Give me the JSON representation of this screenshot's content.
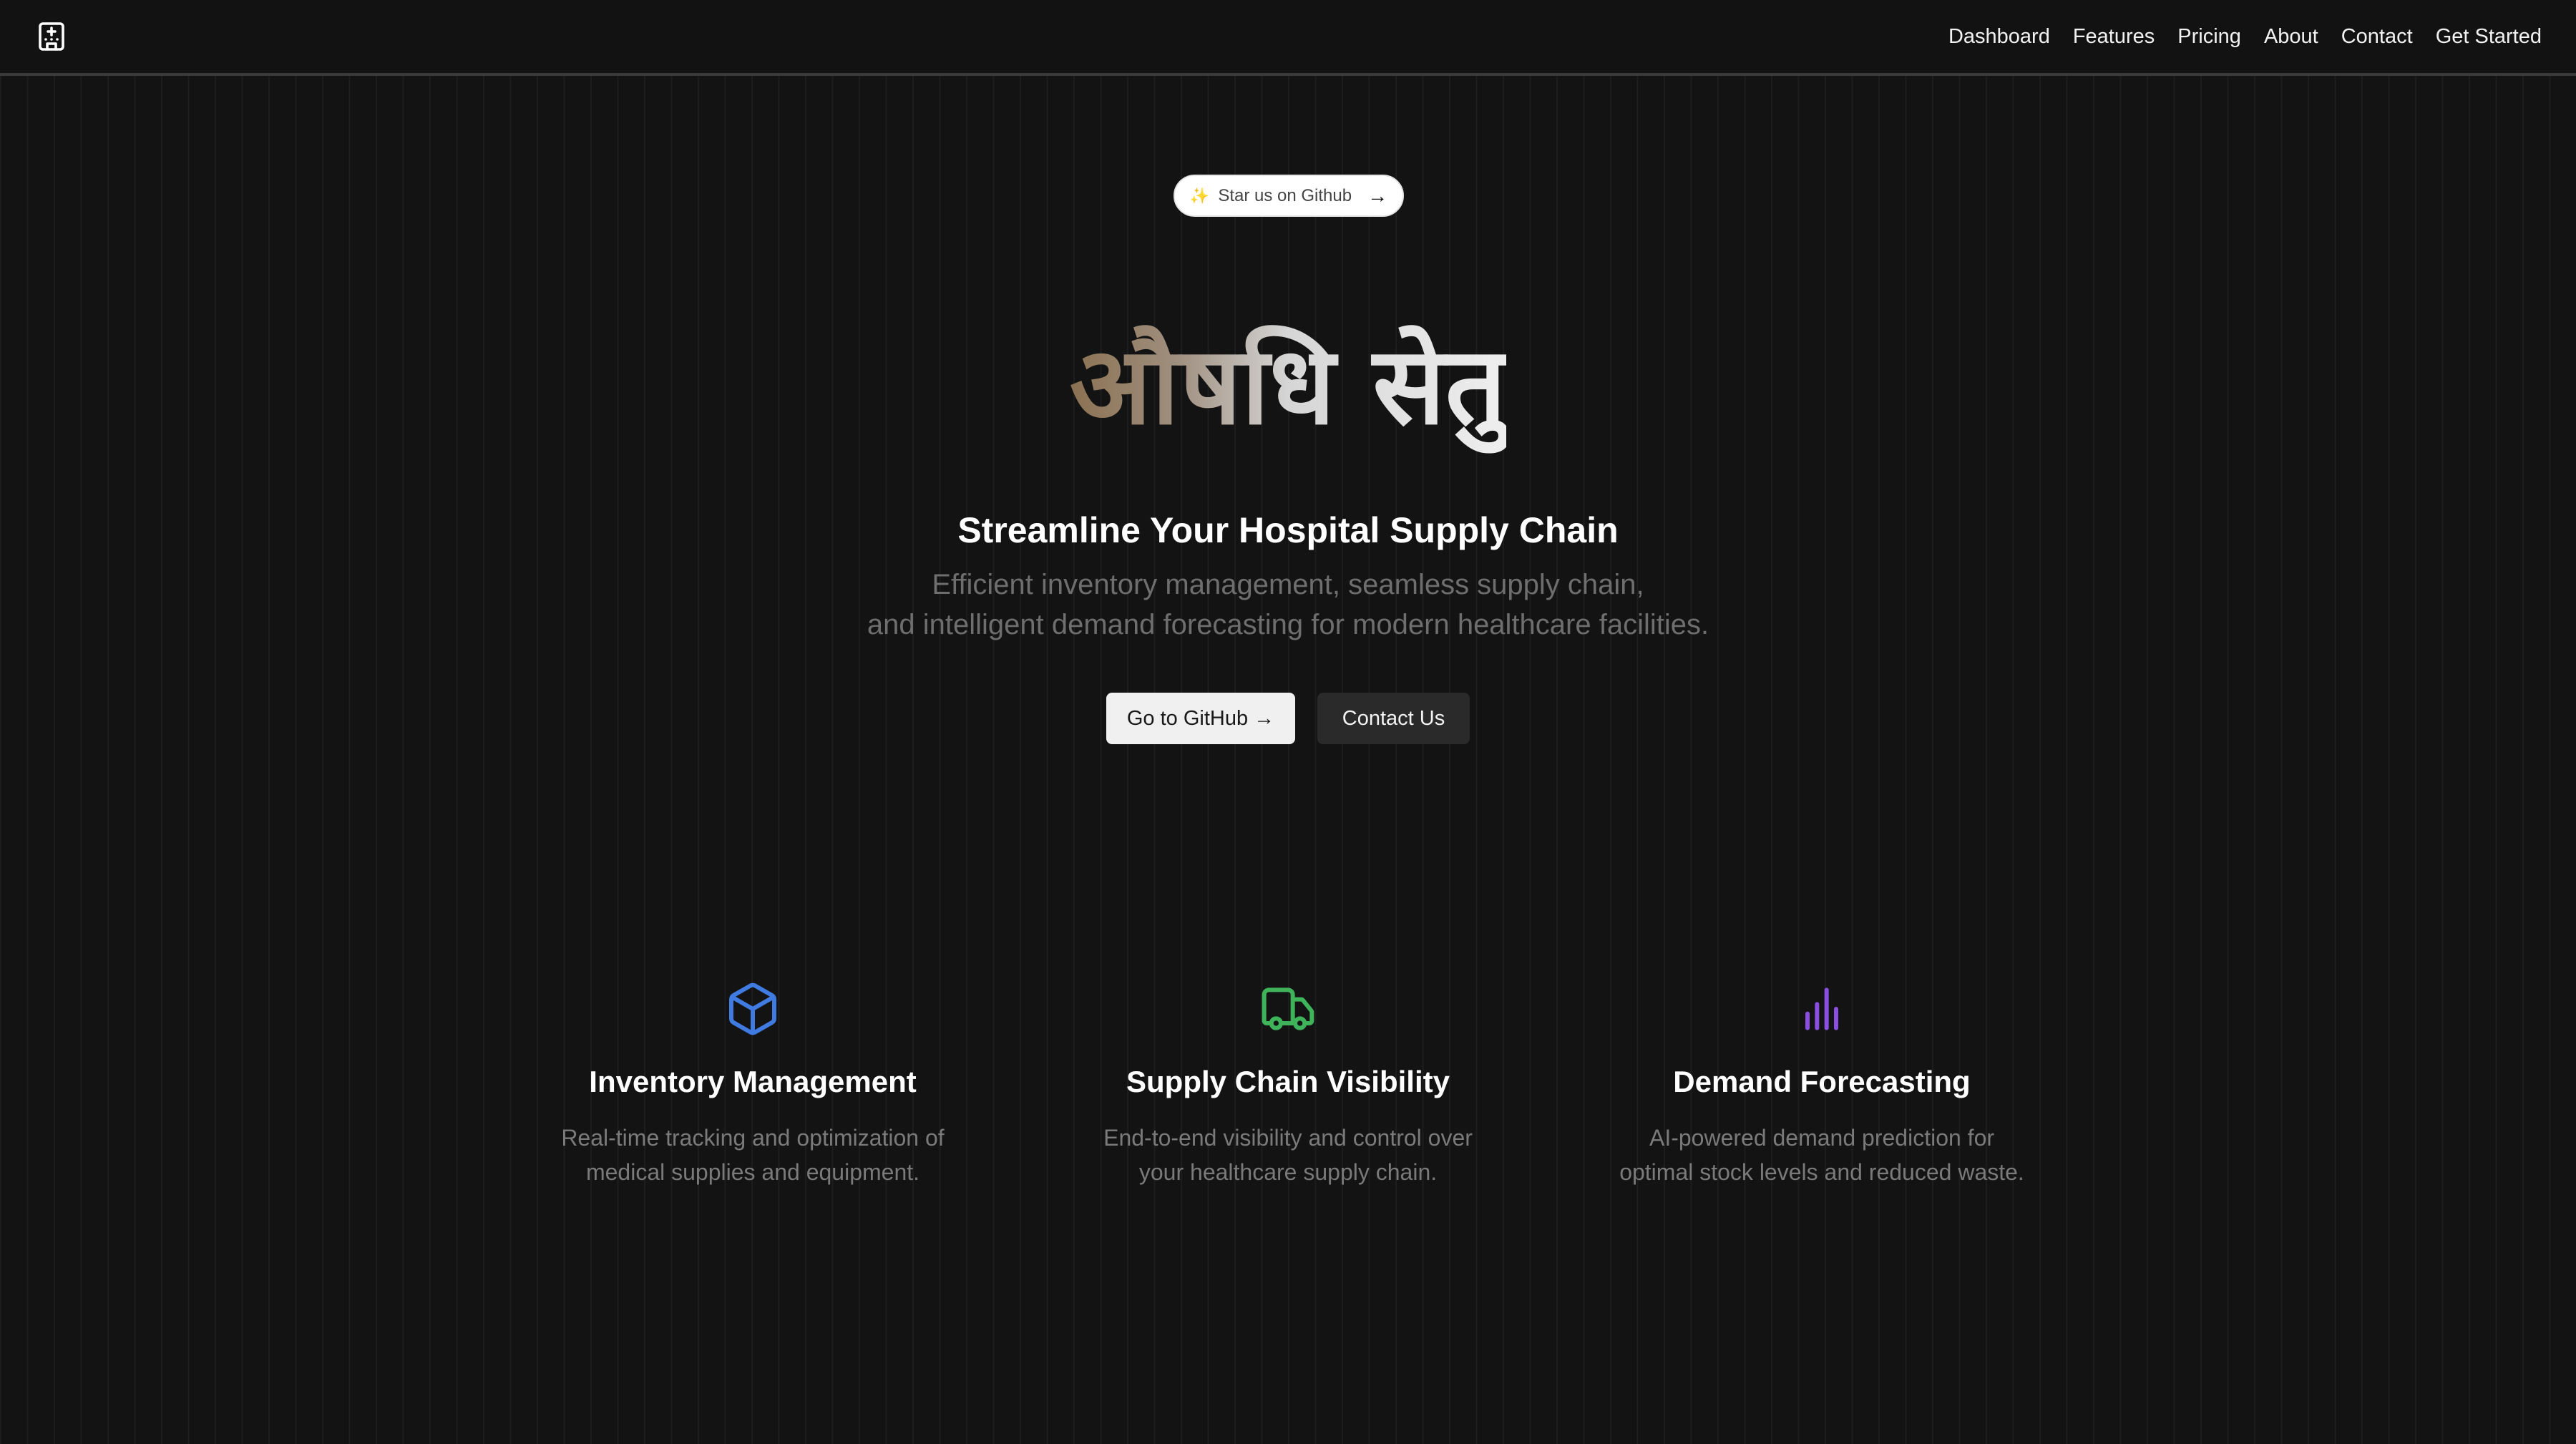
{
  "nav": {
    "logo_icon": "hospital-building-icon",
    "items": [
      "Dashboard",
      "Features",
      "Pricing",
      "About",
      "Contact",
      "Get Started"
    ]
  },
  "hero": {
    "github_pill": {
      "sparkle": "✨",
      "label": "Star us on Github",
      "arrow": "→"
    },
    "brand": "औषधि सेतु",
    "headline": "Streamline Your Hospital Supply Chain",
    "sub_line1": "Efficient inventory management, seamless supply chain,",
    "sub_line2": "and intelligent demand forecasting for modern healthcare facilities.",
    "primary_button": "Go to GitHub →",
    "secondary_button": "Contact Us"
  },
  "features": [
    {
      "icon": "box-icon",
      "color": "#3f7be0",
      "title": "Inventory Management",
      "line1": "Real-time tracking and optimization of",
      "line2": "medical supplies and equipment."
    },
    {
      "icon": "truck-icon",
      "color": "#3fb35a",
      "title": "Supply Chain Visibility",
      "line1": "End-to-end visibility and control over",
      "line2": "your healthcare supply chain."
    },
    {
      "icon": "bar-chart-icon",
      "color": "#8a4fe0",
      "title": "Demand Forecasting",
      "line1": "AI-powered demand prediction for",
      "line2": "optimal stock levels and reduced waste."
    }
  ]
}
